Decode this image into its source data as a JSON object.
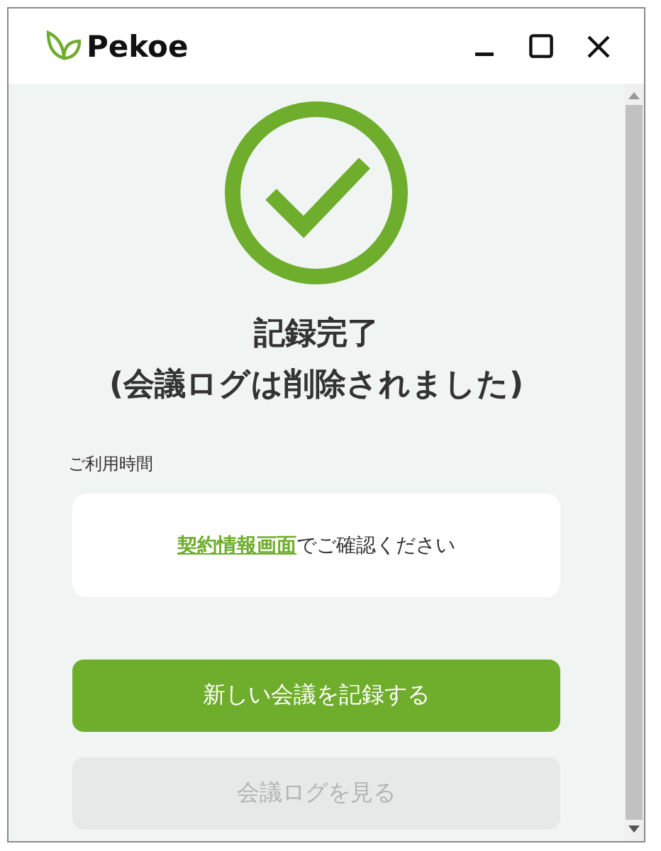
{
  "window": {
    "title": "Pekoe"
  },
  "status": {
    "kind": "success",
    "heading": "記録完了",
    "subheading": "(会議ログは削除されました)"
  },
  "usage": {
    "label": "ご利用時間",
    "link": "契約情報画面",
    "text": "でご確認ください"
  },
  "buttons": [
    {
      "label": "新しい会議を記録する",
      "kind": "primary",
      "disabled": false
    },
    {
      "label": "会議ログを見る",
      "kind": "secondary",
      "disabled": true
    }
  ]
}
